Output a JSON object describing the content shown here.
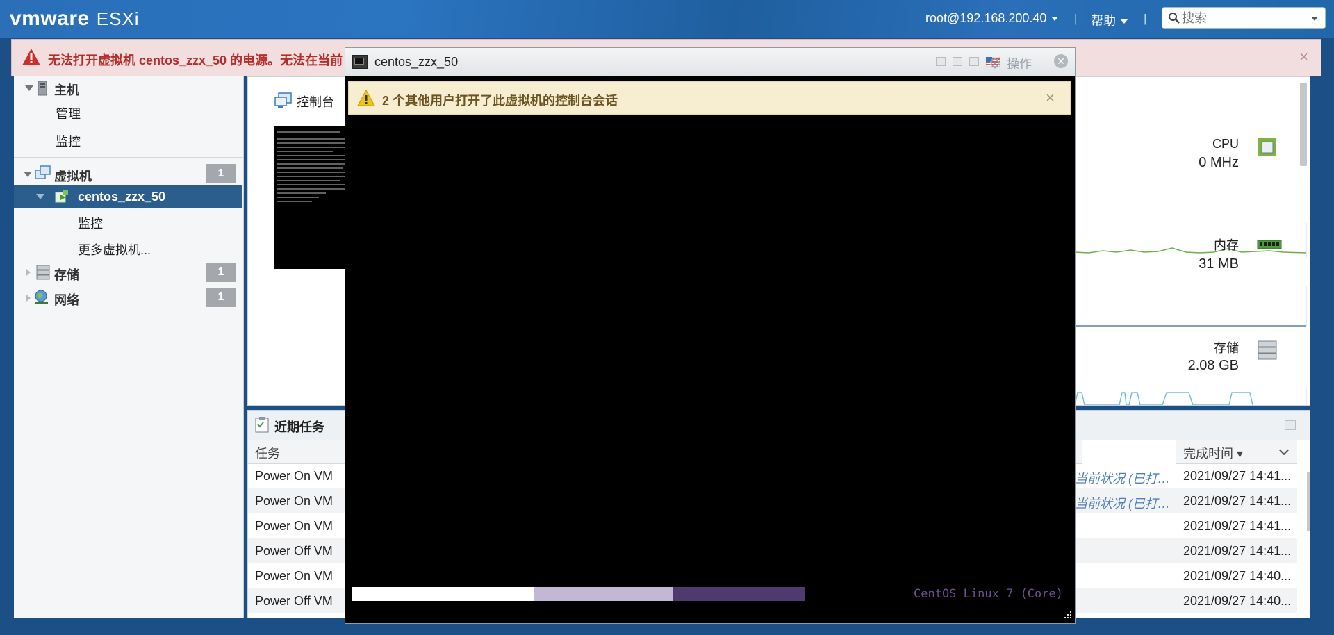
{
  "header": {
    "brand": "vmware",
    "product": "ESXi",
    "user": "root@192.168.200.40",
    "help": "帮助",
    "separator": "|",
    "search_placeholder": "搜索"
  },
  "error_banner": {
    "text": "无法打开虚拟机 centos_zzx_50 的电源。无法在当前",
    "close": "×"
  },
  "navigator": {
    "host": "主机",
    "host_manage": "管理",
    "host_monitor": "监控",
    "vms": "虚拟机",
    "vms_count": "1",
    "vm_selected": "centos_zzx_50",
    "vm_monitor": "监控",
    "more_vms": "更多虚拟机...",
    "storage": "存储",
    "storage_count": "1",
    "network": "网络",
    "network_count": "1"
  },
  "summary": {
    "console_label": "控制台",
    "cpu_label": "CPU",
    "cpu_value": "0 MHz",
    "mem_label": "内存",
    "mem_value": "31 MB",
    "storage_label": "存储",
    "storage_value": "2.08 GB"
  },
  "tasks": {
    "title": "近期任务",
    "col_task": "任务",
    "col_completed": "完成时间 ▾",
    "rows": [
      {
        "task": "Power On VM",
        "result": "当前状况 (已打…",
        "completed": "2021/09/27 14:41..."
      },
      {
        "task": "Power On VM",
        "result": "当前状况 (已打…",
        "completed": "2021/09/27 14:41..."
      },
      {
        "task": "Power On VM",
        "result": "",
        "completed": "2021/09/27 14:41..."
      },
      {
        "task": "Power Off VM",
        "result": "",
        "completed": "2021/09/27 14:41..."
      },
      {
        "task": "Power On VM",
        "result": "",
        "completed": "2021/09/27 14:40..."
      },
      {
        "task": "Power Off VM",
        "result": "",
        "completed": "2021/09/27 14:40..."
      }
    ]
  },
  "console_window": {
    "title": "centos_zzx_50",
    "actions": "操作",
    "warning": "2 个其他用户打开了此虚拟机的控制台会话",
    "boot_text": "CentOS Linux 7 (Core)"
  },
  "colors": {
    "header_blue": "#2b74c0",
    "error_text": "#b42f2c",
    "selected_nav": "#2b5d8d",
    "warning_bg": "#f7eed1",
    "boot_purple": "#6a4f8f"
  }
}
